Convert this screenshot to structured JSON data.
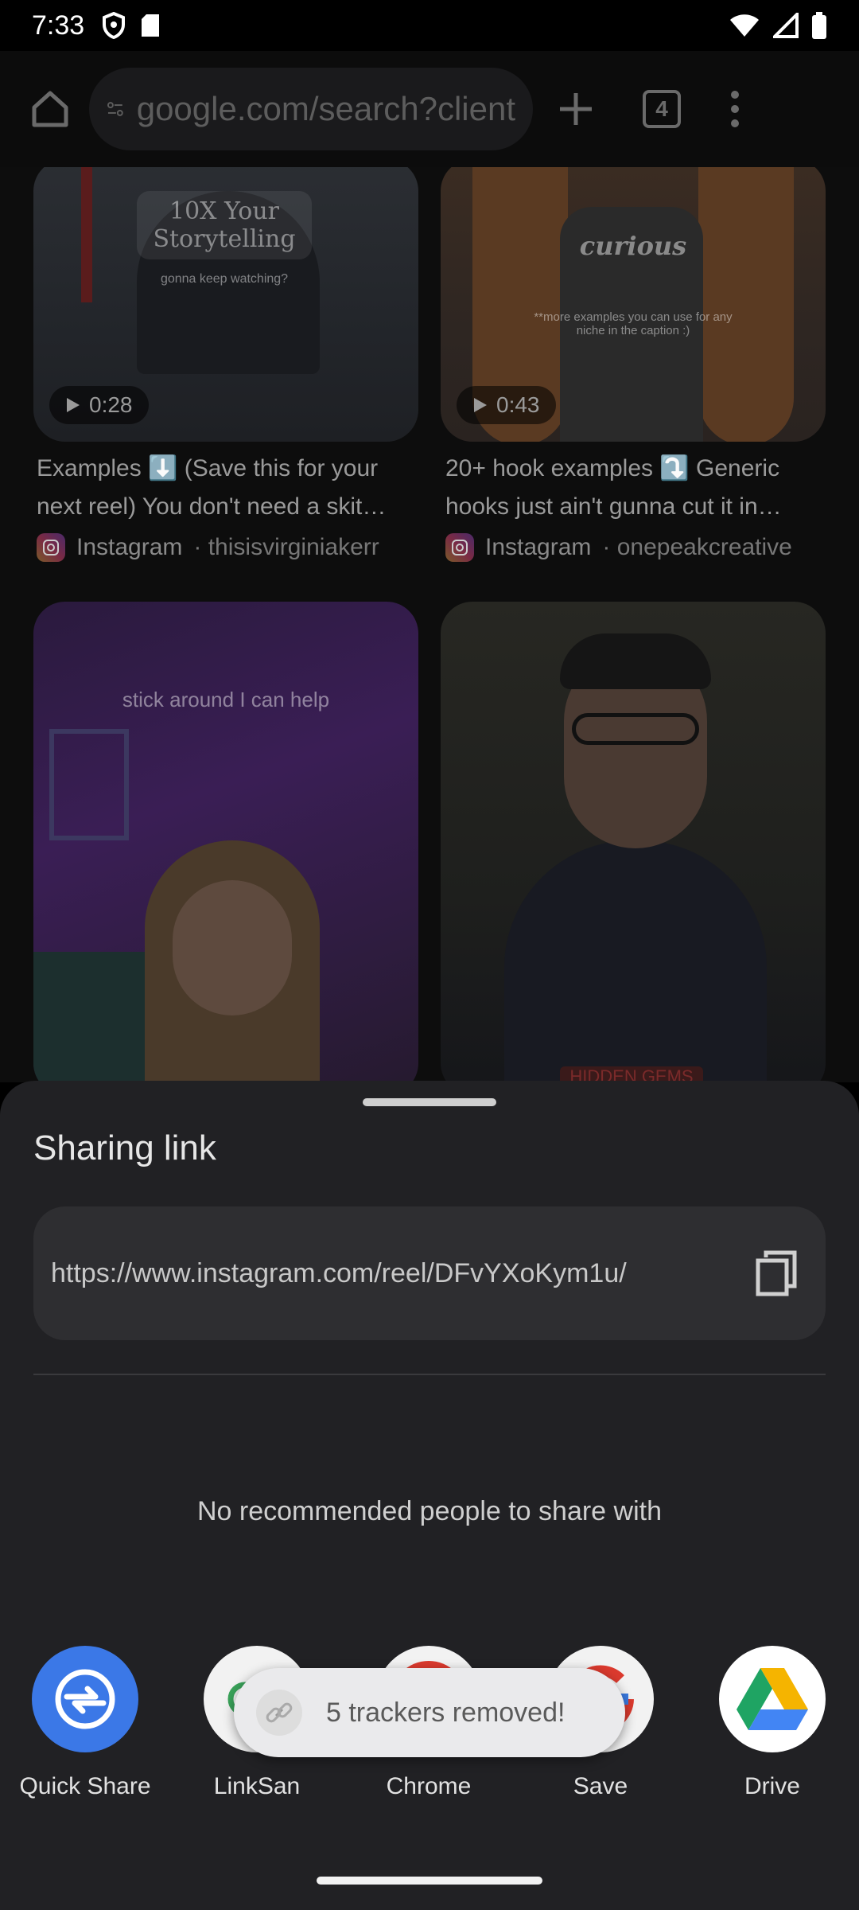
{
  "status_bar": {
    "time": "7:33"
  },
  "browser": {
    "url": "google.com/search?client",
    "tab_count": "4"
  },
  "results": [
    {
      "overlay_line1": "10X Your",
      "overlay_line2": "Storytelling",
      "overlay_sub": "gonna keep watching?",
      "duration": "0:28",
      "title": "Examples ⬇️ (Save this for your next reel) You don't need a skit…",
      "source": "Instagram",
      "channel": "· thisisvirginiakerr"
    },
    {
      "overlay_line1": "curious",
      "overlay_sub": "**more examples you can use for any niche in the caption :)",
      "duration": "0:43",
      "title": "20+ hook examples ⤵️ Generic hooks just ain't gunna cut it in…",
      "source": "Instagram",
      "channel": "· onepeakcreative"
    },
    {
      "overlay_line1": "stick around I can help"
    },
    {
      "overlay_line1": "HIDDEN GEMS"
    }
  ],
  "share_sheet": {
    "title": "Sharing link",
    "link": "https://www.instagram.com/reel/DFvYXoKym1u/",
    "no_people": "No recommended people to share with",
    "apps": [
      {
        "label": "Quick Share",
        "color": "#3b78e7"
      },
      {
        "label": "LinkSan"
      },
      {
        "label": "Chrome"
      },
      {
        "label": "Save"
      },
      {
        "label": "Drive"
      }
    ],
    "toast": "5 trackers removed!"
  }
}
